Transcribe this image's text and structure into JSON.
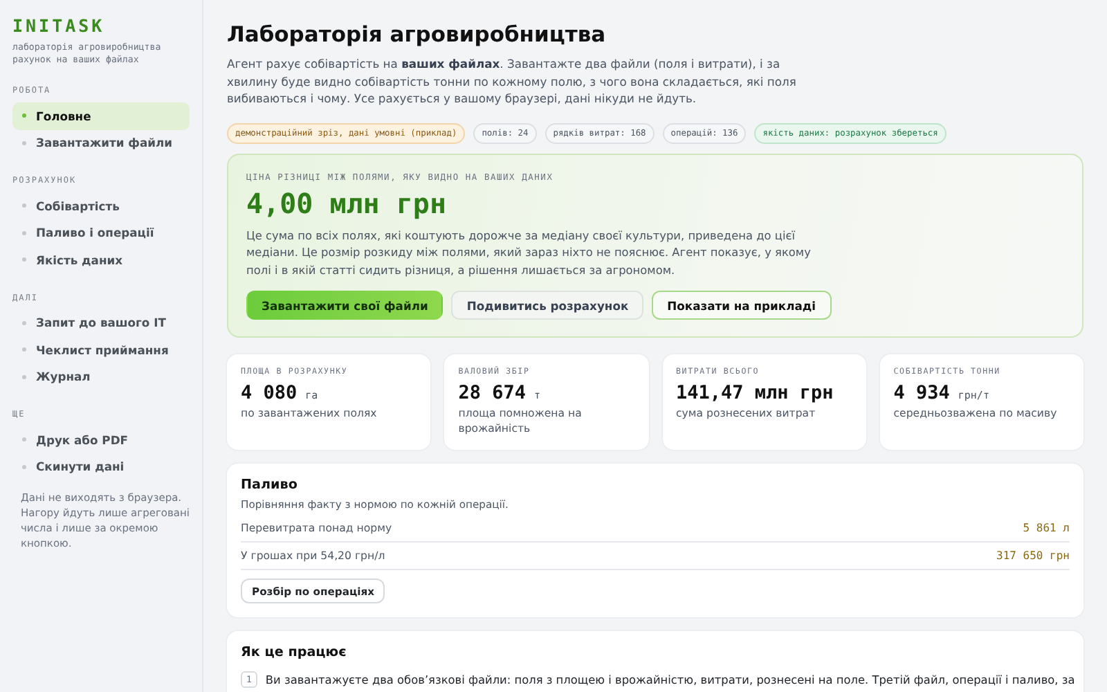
{
  "brand": {
    "name": "INITASK",
    "tagline": "лабораторія агровиробництва\nрахунок на ваших файлах"
  },
  "sidebar": {
    "groups": [
      {
        "title": "РОБОТА",
        "items": [
          {
            "label": "Головне",
            "selected": true
          },
          {
            "label": "Завантажити файли",
            "selected": false
          }
        ]
      },
      {
        "title": "РОЗРАХУНОК",
        "items": [
          {
            "label": "Собівартість",
            "selected": false
          },
          {
            "label": "Паливо і операції",
            "selected": false
          },
          {
            "label": "Якість даних",
            "selected": false
          }
        ]
      },
      {
        "title": "ДАЛІ",
        "items": [
          {
            "label": "Запит до вашого IT",
            "selected": false
          },
          {
            "label": "Чеклист приймання",
            "selected": false
          },
          {
            "label": "Журнал",
            "selected": false
          }
        ]
      },
      {
        "title": "ЩЕ",
        "items": [
          {
            "label": "Друк або PDF",
            "selected": false
          },
          {
            "label": "Скинути дані",
            "selected": false
          }
        ]
      }
    ],
    "note": "Дані не виходять з браузера. Нагору йдуть лише агреговані числа і лише за окремою кнопкою."
  },
  "page": {
    "title": "Лабораторія агровиробництва",
    "intro": "Агент рахує собівартість на **ваших файлах**. Завантажте два файли (поля і витрати), і за хвилину буде видно собівартість тонни по кожному полю, з чого вона складається, які поля вибиваються і чому. Усе рахується у вашому браузері, дані нікуди не йдуть.",
    "chips": [
      {
        "label": "демонстраційний зріз, дані умовні (приклад)",
        "kind": "warning"
      },
      {
        "label": "полів: 24",
        "kind": "neutral"
      },
      {
        "label": "рядків витрат: 168",
        "kind": "neutral"
      },
      {
        "label": "операцій: 136",
        "kind": "neutral"
      },
      {
        "label": "якість даних: розрахунок збереться",
        "kind": "success"
      }
    ]
  },
  "hero": {
    "eyebrow": "ЦІНА РІЗНИЦІ МІЖ ПОЛЯМИ, ЯКУ ВИДНО НА ВАШИХ ДАНИХ",
    "value": "4,00 млн грн",
    "text": "Це сума по всіх полях, які коштують дорожче за медіану своєї культури, приведена до цієї медіани. Це розмір розкиду між полями, який зараз ніхто не пояснює. Агент показує, у якому полі і в якій статті сидить різниця, а рішення лишається за агрономом.",
    "buttons": [
      {
        "label": "Завантажити свої файли",
        "kind": "primary"
      },
      {
        "label": "Подивитись розрахунок",
        "kind": "secondary"
      },
      {
        "label": "Показати на прикладі",
        "kind": "outline"
      }
    ]
  },
  "stats": [
    {
      "label": "ПЛОЩА В РОЗРАХУНКУ",
      "value": "4 080",
      "unit": "га",
      "note": "по завантажених полях"
    },
    {
      "label": "ВАЛОВИЙ ЗБІР",
      "value": "28 674",
      "unit": "т",
      "note": "площа помножена на врожайність"
    },
    {
      "label": "ВИТРАТИ ВСЬОГО",
      "value": "141,47 млн грн",
      "note": "сума рознесених витрат"
    },
    {
      "label": "СОБІВАРТІСТЬ ТОННИ",
      "value": "4 934",
      "unit": "грн/т",
      "note": "середньозважена по масиву"
    }
  ],
  "fuel": {
    "title": "Паливо",
    "subtitle": "Порівняння факту з нормою по кожній операції.",
    "rows": [
      {
        "label": "Перевитрата понад норму",
        "value": "5 861 л"
      },
      {
        "label": "У грошах при 54,20 грн/л",
        "value": "317 650 грн"
      }
    ],
    "button": "Розбір по операціях"
  },
  "how": {
    "title": "Як це працює",
    "steps": [
      {
        "number": "1",
        "text": "Ви завантажуєте два обов’язкові файли: поля з площею і врожайністю, витрати, рознесені на поле. Третій файл, операції і паливо, за"
      }
    ]
  }
}
